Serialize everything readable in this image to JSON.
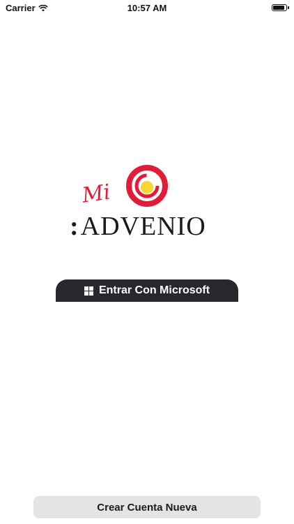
{
  "status_bar": {
    "carrier": "Carrier",
    "time": "10:57 AM",
    "wifi_icon": "wifi-icon",
    "battery_icon": "battery-icon"
  },
  "logo": {
    "mi": "Mi",
    "brand": "ADVENIO",
    "prefix": ":",
    "brand_color": "#e21b38",
    "accent_yellow": "#f8d532"
  },
  "buttons": {
    "microsoft_login": "Entrar Con Microsoft",
    "microsoft_icon": "windows-icon",
    "create_account": "Crear Cuenta Nueva"
  }
}
